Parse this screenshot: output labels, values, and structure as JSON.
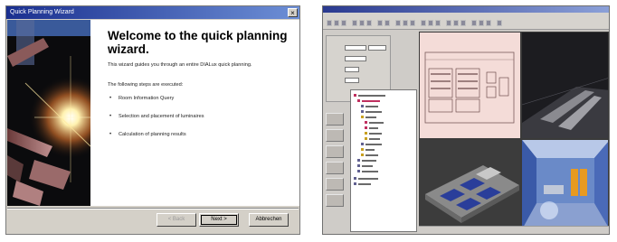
{
  "wizard": {
    "title": "Quick Planning Wizard",
    "close_glyph": "×",
    "heading": "Welcome to the quick planning wizard.",
    "intro": "This wizard guides you through an entire DIALux quick planning.",
    "steps_intro": "The following steps are executed:",
    "steps": [
      "Room Information Query",
      "Selection and placement of luminaires",
      "Calculation of planning results"
    ],
    "buttons": {
      "back": "< Back",
      "next": "Next >",
      "cancel": "Abbrechen"
    }
  },
  "app": {
    "views": [
      "plan-view",
      "perspective-view",
      "isometric-view",
      "room-render-view"
    ]
  }
}
